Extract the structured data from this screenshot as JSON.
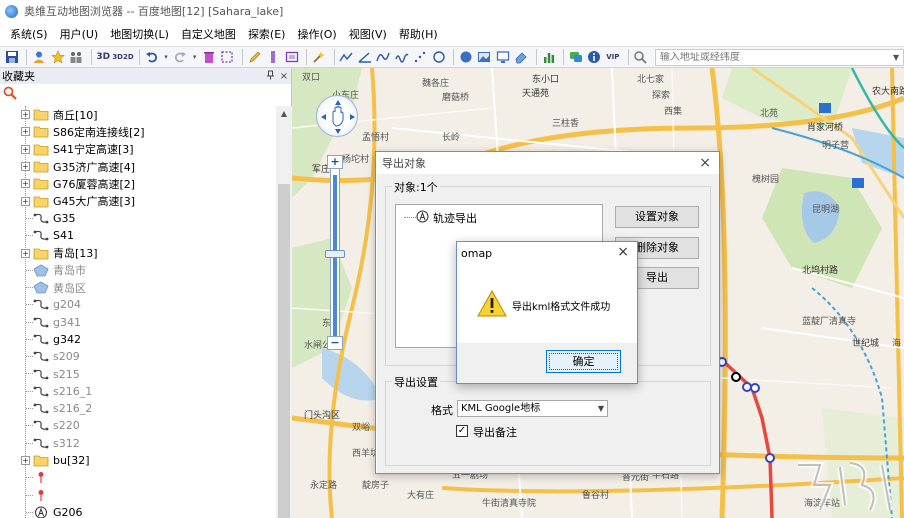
{
  "window": {
    "title": "奥维互动地图浏览器 -- 百度地图[12] [Sahara_lake]"
  },
  "menu": [
    {
      "id": "system",
      "label": "系统(S)"
    },
    {
      "id": "user",
      "label": "用户(U)"
    },
    {
      "id": "map-switch",
      "label": "地图切换(L)"
    },
    {
      "id": "custom-map",
      "label": "自定义地图"
    },
    {
      "id": "explore",
      "label": "探索(E)"
    },
    {
      "id": "operate",
      "label": "操作(O)"
    },
    {
      "id": "view",
      "label": "视图(V)"
    },
    {
      "id": "help",
      "label": "帮助(H)"
    }
  ],
  "toolbar": {
    "text_3d": "3D",
    "text_3d_2d": "3D2D",
    "vip": "VIP",
    "search_placeholder": "输入地址或经纬度"
  },
  "favorites": {
    "title": "收藏夹",
    "pin": "ᵖ",
    "close": "×"
  },
  "tree": [
    {
      "label": "商丘[10]",
      "type": "folder",
      "expander": "+",
      "muted": false
    },
    {
      "label": "S86定南连接线[2]",
      "type": "folder",
      "expander": "+",
      "muted": false
    },
    {
      "label": "S41宁定高速[3]",
      "type": "folder",
      "expander": "+",
      "muted": false
    },
    {
      "label": "G35济广高速[4]",
      "type": "folder",
      "expander": "+",
      "muted": false
    },
    {
      "label": "G76厦蓉高速[2]",
      "type": "folder",
      "expander": "+",
      "muted": false
    },
    {
      "label": "G45大广高速[3]",
      "type": "folder",
      "expander": "+",
      "muted": false
    },
    {
      "label": "G35",
      "type": "track",
      "expander": "",
      "muted": false
    },
    {
      "label": "S41",
      "type": "track",
      "expander": "",
      "muted": false
    },
    {
      "label": "青岛[13]",
      "type": "folder",
      "expander": "+",
      "muted": false
    },
    {
      "label": "青岛市",
      "type": "area",
      "expander": "",
      "muted": true
    },
    {
      "label": "黄岛区",
      "type": "area",
      "expander": "",
      "muted": true
    },
    {
      "label": "g204",
      "type": "track",
      "expander": "",
      "muted": true
    },
    {
      "label": "g341",
      "type": "track",
      "expander": "",
      "muted": true
    },
    {
      "label": "g342",
      "type": "track",
      "expander": "",
      "muted": false
    },
    {
      "label": "s209",
      "type": "track",
      "expander": "",
      "muted": true
    },
    {
      "label": "s215",
      "type": "track",
      "expander": "",
      "muted": true
    },
    {
      "label": "s216_1",
      "type": "track",
      "expander": "",
      "muted": true
    },
    {
      "label": "s216_2",
      "type": "track",
      "expander": "",
      "muted": true
    },
    {
      "label": "s220",
      "type": "track",
      "expander": "",
      "muted": true
    },
    {
      "label": "s312",
      "type": "track",
      "expander": "",
      "muted": true
    },
    {
      "label": "bu[32]",
      "type": "folder",
      "expander": "+",
      "muted": false
    },
    {
      "label": "",
      "type": "pin",
      "expander": "",
      "muted": false
    },
    {
      "label": "",
      "type": "pin",
      "expander": "",
      "muted": false
    },
    {
      "label": "G206",
      "type": "route",
      "expander": "",
      "muted": false
    }
  ],
  "map": {
    "labels": [
      {
        "text": "双口",
        "dark": false
      },
      {
        "text": "魏各庄",
        "dark": false
      },
      {
        "text": "东小口",
        "dark": true
      },
      {
        "text": "北七家",
        "dark": false
      },
      {
        "text": "农大南路",
        "dark": true
      },
      {
        "text": "小东庄",
        "dark": false
      },
      {
        "text": "磨菇桥",
        "dark": false
      },
      {
        "text": "天通苑",
        "dark": true
      },
      {
        "text": "探索",
        "dark": false
      },
      {
        "text": "三柱香",
        "dark": false
      },
      {
        "text": "西集",
        "dark": false
      },
      {
        "text": "北苑",
        "dark": false
      },
      {
        "text": "肖家河桥",
        "dark": true
      },
      {
        "text": "长岭",
        "dark": false
      },
      {
        "text": "孟悟村",
        "dark": false
      },
      {
        "text": "明子营",
        "dark": false
      },
      {
        "text": "杨坨村",
        "dark": false
      },
      {
        "text": "军庄",
        "dark": true
      },
      {
        "text": "槐树园",
        "dark": false
      },
      {
        "text": "昆明湖",
        "dark": false
      },
      {
        "text": "北坞村路",
        "dark": true
      },
      {
        "text": "蓝靛厂清真寺",
        "dark": false
      },
      {
        "text": "世纪城",
        "dark": true
      },
      {
        "text": "海",
        "dark": false
      },
      {
        "text": "东沟",
        "dark": false
      },
      {
        "text": "水闸公",
        "dark": false
      },
      {
        "text": "门头沟区",
        "dark": true
      },
      {
        "text": "双峪",
        "dark": false
      },
      {
        "text": "西羊坊",
        "dark": false
      },
      {
        "text": "永定路",
        "dark": false
      },
      {
        "text": "大有庄",
        "dark": false
      },
      {
        "text": "五一剧场",
        "dark": false
      },
      {
        "text": "牛街清真寺院",
        "dark": false
      },
      {
        "text": "鲁谷村",
        "dark": false
      },
      {
        "text": "半石路",
        "dark": false
      },
      {
        "text": "普元街",
        "dark": false
      },
      {
        "text": "靛房子",
        "dark": false
      },
      {
        "text": "海淀车站",
        "dark": false
      }
    ]
  },
  "export_dialog": {
    "title": "导出对象",
    "close": "×",
    "objects_group": "对象:1个",
    "tree_item": "轨迹导出",
    "btn_set": "设置对象",
    "btn_delete": "删除对象",
    "btn_export": "导出",
    "settings_group": "导出设置",
    "format_label": "格式",
    "format_value": "KML Google地标",
    "note_label": "导出备注",
    "note_checked": "✓"
  },
  "msgbox": {
    "title": "omap",
    "close": "×",
    "message": "导出kml格式文件成功",
    "ok": "确定"
  },
  "colors": {
    "highway": "#f5c04a",
    "subway_red": "#e9463d",
    "subway_teal": "#33b8a4",
    "water": "#a6c9e8",
    "park": "#cce3b0",
    "ok_border": "#0078d7"
  }
}
